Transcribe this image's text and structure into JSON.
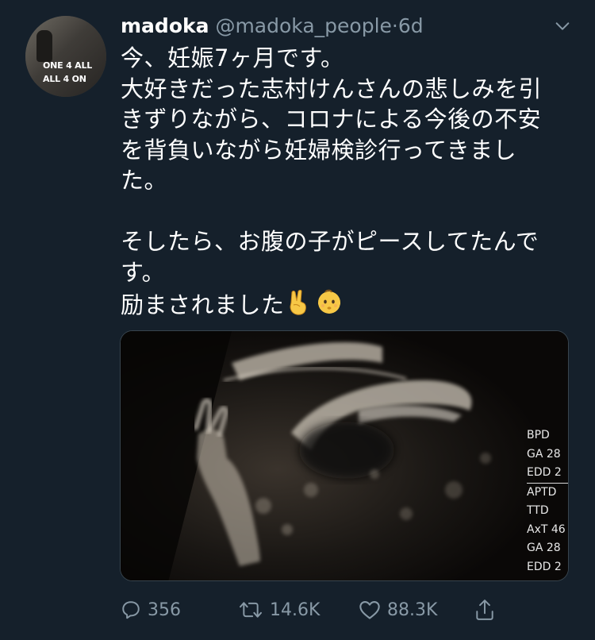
{
  "author": {
    "display_name": "madoka",
    "handle": "@madoka_people",
    "separator": "·",
    "time": "6d",
    "avatar_text": [
      "ONE 4 ALL",
      "ALL 4 ON"
    ]
  },
  "tweet": {
    "lines": [
      "今、妊娠7ヶ月です。",
      "大好きだった志村けんさんの悲しみを引",
      "きずりながら、コロナによる今後の不安",
      "を背負いながら妊婦検診行ってきまし",
      "た。",
      "",
      "そしたら、お腹の子がピースしてたんで",
      "す。",
      "励まされました"
    ],
    "emojis": [
      "victory-hand",
      "baby"
    ]
  },
  "media": {
    "ultrasound_labels": [
      "BPD",
      "GA 28",
      "EDD 2",
      "APTD",
      "TTD",
      "AxT 46",
      "GA 28",
      "EDD 2"
    ]
  },
  "actions": {
    "reply_count": "356",
    "retweet_count": "14.6K",
    "like_count": "88.3K"
  },
  "colors": {
    "background": "#15202b",
    "text": "#ffffff",
    "secondary": "#8899a6",
    "border": "#38444d"
  }
}
